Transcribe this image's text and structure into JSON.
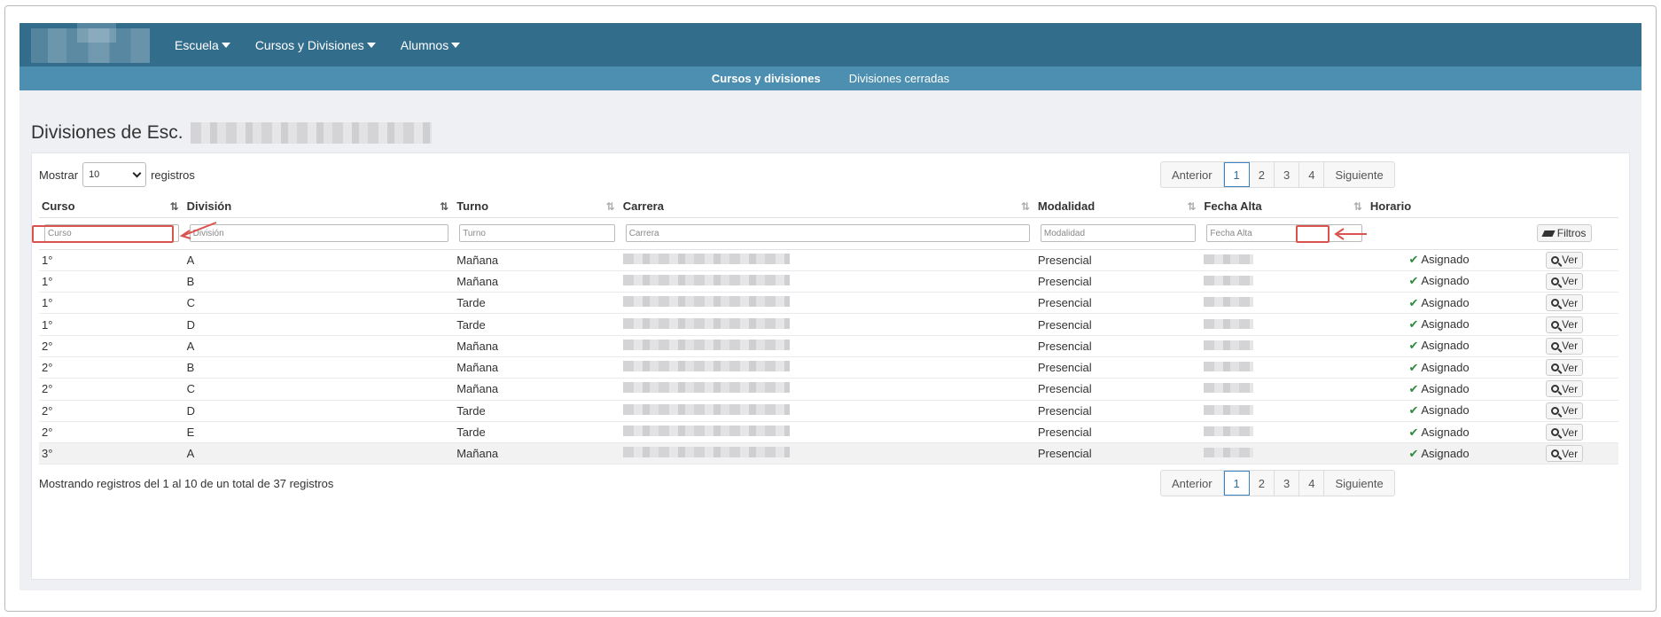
{
  "nav": {
    "menu": [
      {
        "label": "Escuela"
      },
      {
        "label": "Cursos y Divisiones"
      },
      {
        "label": "Alumnos"
      }
    ],
    "subnav": [
      {
        "label": "Cursos y divisiones",
        "active": true
      },
      {
        "label": "Divisiones cerradas",
        "active": false
      }
    ]
  },
  "page": {
    "title": "Divisiones de Esc."
  },
  "length": {
    "prefix": "Mostrar",
    "value": "10",
    "suffix": "registros"
  },
  "pager": {
    "prev": "Anterior",
    "next": "Siguiente",
    "pages": [
      "1",
      "2",
      "3",
      "4"
    ],
    "current": "1"
  },
  "table": {
    "headers": [
      "Curso",
      "División",
      "Turno",
      "Carrera",
      "Modalidad",
      "Fecha Alta",
      "Horario"
    ],
    "filters": [
      "Curso",
      "División",
      "Turno",
      "Carrera",
      "Modalidad",
      "Fecha Alta"
    ],
    "filter_button": "Filtros",
    "rows": [
      {
        "curso": "1°",
        "division": "A",
        "turno": "Mañana",
        "modalidad": "Presencial",
        "horario": "Asignado",
        "accion": "Ver"
      },
      {
        "curso": "1°",
        "division": "B",
        "turno": "Mañana",
        "modalidad": "Presencial",
        "horario": "Asignado",
        "accion": "Ver"
      },
      {
        "curso": "1°",
        "division": "C",
        "turno": "Tarde",
        "modalidad": "Presencial",
        "horario": "Asignado",
        "accion": "Ver"
      },
      {
        "curso": "1°",
        "division": "D",
        "turno": "Tarde",
        "modalidad": "Presencial",
        "horario": "Asignado",
        "accion": "Ver"
      },
      {
        "curso": "2°",
        "division": "A",
        "turno": "Mañana",
        "modalidad": "Presencial",
        "horario": "Asignado",
        "accion": "Ver"
      },
      {
        "curso": "2°",
        "division": "B",
        "turno": "Mañana",
        "modalidad": "Presencial",
        "horario": "Asignado",
        "accion": "Ver"
      },
      {
        "curso": "2°",
        "division": "C",
        "turno": "Mañana",
        "modalidad": "Presencial",
        "horario": "Asignado",
        "accion": "Ver"
      },
      {
        "curso": "2°",
        "division": "D",
        "turno": "Tarde",
        "modalidad": "Presencial",
        "horario": "Asignado",
        "accion": "Ver"
      },
      {
        "curso": "2°",
        "division": "E",
        "turno": "Tarde",
        "modalidad": "Presencial",
        "horario": "Asignado",
        "accion": "Ver"
      },
      {
        "curso": "3°",
        "division": "A",
        "turno": "Mañana",
        "modalidad": "Presencial",
        "horario": "Asignado",
        "accion": "Ver"
      }
    ]
  },
  "info": "Mostrando registros del 1 al 10 de un total de 37 registros",
  "colors": {
    "nav": "#336d8c",
    "subnav": "#4d8fb0",
    "highlight": "#d9534f",
    "check": "#2e8b3e"
  }
}
